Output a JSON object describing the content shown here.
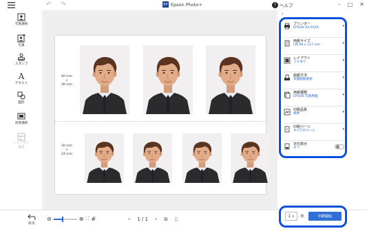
{
  "titlebar": {
    "app_title": "Epson Photo+",
    "app_logo": "EP",
    "help_label": "ヘルプ"
  },
  "sidebar": {
    "items": [
      {
        "label": "写真選択",
        "icon": "photo-select-icon"
      },
      {
        "label": "写真",
        "icon": "photo-add-icon"
      },
      {
        "label": "スタンプ",
        "icon": "stamp-icon"
      },
      {
        "label": "テキスト",
        "icon": "text-icon"
      },
      {
        "label": "図形",
        "icon": "shape-icon"
      },
      {
        "label": "背景選択",
        "icon": "background-icon"
      },
      {
        "label": "レイアウト\n設定",
        "icon": "layout-settings-icon",
        "disabled": true
      }
    ]
  },
  "canvas": {
    "row1_size": "40 mm\n×\n30 mm",
    "row2_size": "30 mm\n×\n24 mm"
  },
  "panel": {
    "items": [
      {
        "title": "プリンター",
        "value": "EPSON XX-XXXX",
        "icon": "printer-icon"
      },
      {
        "title": "用紙サイズ",
        "value": "L判 89 x 127 mm",
        "icon": "paper-size-icon"
      },
      {
        "title": "レイアウト",
        "value": "フチあり",
        "icon": "layout-icon"
      },
      {
        "title": "給紙方法",
        "value": "背面給紙選択",
        "icon": "paper-feed-icon"
      },
      {
        "title": "用紙種類",
        "value": "EPSON 写真用紙",
        "icon": "paper-type-icon"
      },
      {
        "title": "印刷品質",
        "value": "標準",
        "icon": "print-quality-icon"
      },
      {
        "title": "印刷ページ",
        "value": "すべてのページ",
        "icon": "print-pages-icon"
      },
      {
        "title": "日付表示",
        "value": "オフ",
        "icon": "date-icon"
      }
    ]
  },
  "bottombar": {
    "back_label": "戻る",
    "page": "1 / 1",
    "copies": "1",
    "print_label": "印刷開始"
  },
  "colors": {
    "accent": "#2f6fd6",
    "highlight_border": "#0a4fd9"
  }
}
